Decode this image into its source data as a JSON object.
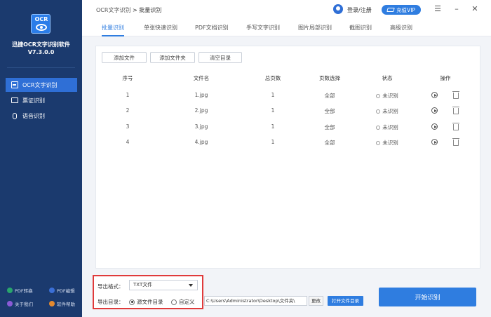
{
  "app": {
    "logo_text": "OCR",
    "name": "迅捷OCR文字识别软件",
    "version": "V7.3.0.0"
  },
  "sidebar": {
    "items": [
      {
        "label": "OCR文字识别",
        "icon": "scan-icon",
        "active": true
      },
      {
        "label": "票证识别",
        "icon": "card-icon",
        "active": false
      },
      {
        "label": "语音识别",
        "icon": "mic-icon",
        "active": false
      }
    ],
    "bottom_links": [
      {
        "label": "PDF转换",
        "icon": "pdf-convert-icon",
        "color": "#29a56c"
      },
      {
        "label": "PDF编辑",
        "icon": "pdf-edit-icon",
        "color": "#3b6fd6"
      },
      {
        "label": "关于我们",
        "icon": "about-icon",
        "color": "#8a5ad6"
      },
      {
        "label": "软件帮助",
        "icon": "help-icon",
        "color": "#e58a2f"
      }
    ]
  },
  "topbar": {
    "breadcrumb_root": "OCR文字识别",
    "breadcrumb_current": "> 批量识别",
    "login_label": "登录/注册",
    "vip_label": "充值VIP"
  },
  "tabs": [
    {
      "label": "批量识别",
      "active": true
    },
    {
      "label": "单张快速识别",
      "active": false
    },
    {
      "label": "PDF文档识别",
      "active": false
    },
    {
      "label": "手写文字识别",
      "active": false
    },
    {
      "label": "图片局部识别",
      "active": false
    },
    {
      "label": "截图识别",
      "active": false
    },
    {
      "label": "高级识别",
      "active": false
    }
  ],
  "toolbar": {
    "add_file": "添加文件",
    "add_folder": "添加文件夹",
    "clear_list": "清空目录"
  },
  "table": {
    "headers": [
      "序号",
      "文件名",
      "总页数",
      "页数选择",
      "状态",
      "操作"
    ],
    "rows": [
      {
        "index": "1",
        "filename": "1.jpg",
        "pages": "1",
        "page_select": "全部",
        "status": "未识别"
      },
      {
        "index": "2",
        "filename": "2.jpg",
        "pages": "1",
        "page_select": "全部",
        "status": "未识别"
      },
      {
        "index": "3",
        "filename": "3.jpg",
        "pages": "1",
        "page_select": "全部",
        "status": "未识别"
      },
      {
        "index": "4",
        "filename": "4.jpg",
        "pages": "1",
        "page_select": "全部",
        "status": "未识别"
      }
    ]
  },
  "export": {
    "format_label": "导出格式：",
    "format_value": "TXT文件",
    "dir_label": "导出目录：",
    "option_source": "源文件目录",
    "option_custom": "自定义",
    "selected": "source",
    "path_value": "C:\\Users\\Administrator\\Desktop\\文件夹\\",
    "change_label": "更改",
    "open_dir_label": "打开文件目录",
    "start_label": "开始识别"
  },
  "colors": {
    "sidebar_bg": "#1b3a6e",
    "accent": "#2f7de0",
    "highlight_border": "#e03b3b"
  }
}
